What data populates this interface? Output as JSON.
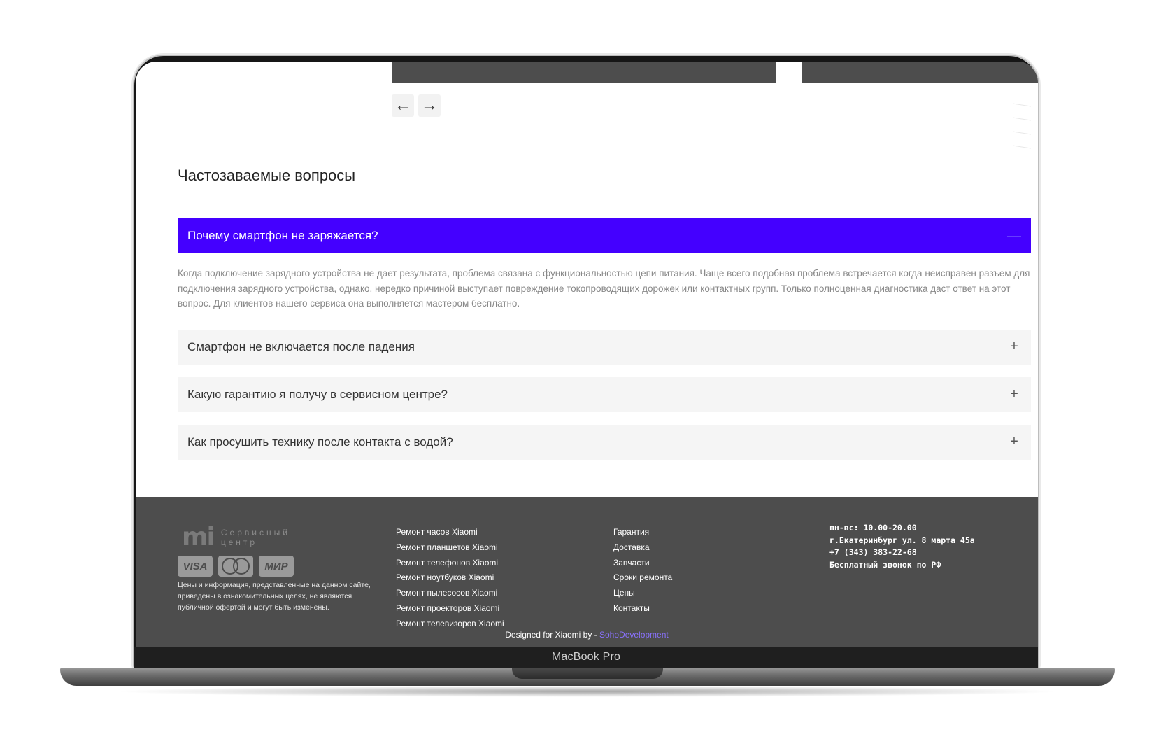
{
  "device": {
    "label": "MacBook Pro"
  },
  "nav": {
    "prev_icon": "arrow-left-icon",
    "next_icon": "arrow-right-icon",
    "prev_glyph": "←",
    "next_glyph": "→"
  },
  "faq": {
    "title": "Частозаваемые вопросы",
    "items": [
      {
        "question": "Почему смартфон не заряжается?",
        "open": true,
        "toggle": "—",
        "answer": "Когда подключение зарядного устройства не дает результата, проблема связана с функциональностью цепи питания. Чаще всего подобная проблема встречается когда неисправен разъем для подключения зарядного устройства, однако, нередко причиной выступает повреждение токопроводящих дорожек или контактных групп. Только полноценная диагностика даст ответ на этот вопрос. Для клиентов нашего сервиса она выполняется мастером бесплатно."
      },
      {
        "question": "Смартфон не включается после падения",
        "open": false,
        "toggle": "+"
      },
      {
        "question": "Какую гарантию я получу в сервисном центре?",
        "open": false,
        "toggle": "+"
      },
      {
        "question": "Как просушить технику после контакта с водой?",
        "open": false,
        "toggle": "+"
      }
    ],
    "accent_color": "#4400ff"
  },
  "footer": {
    "logo": {
      "mark": "mi",
      "line1": "Сервисный",
      "line2": "центр"
    },
    "payments": {
      "visa": "VISA",
      "mir": "МИР",
      "mastercard_icon": "mastercard-icon"
    },
    "disclaimer": "Цены и информация, представленные на данном сайте, приведены в ознакомительных целях, не являются публичной офертой и могут быть изменены.",
    "services": [
      "Ремонт часов Xiaomi",
      "Ремонт планшетов Xiaomi",
      "Ремонт телефонов Xiaomi",
      "Ремонт ноутбуков Xiaomi",
      "Ремонт пылесосов Xiaomi",
      "Ремонт проекторов Xiaomi",
      "Ремонт телевизоров Xiaomi"
    ],
    "links": [
      "Гарантия",
      "Доставка",
      "Запчасти",
      "Сроки ремонта",
      "Цены",
      "Контакты"
    ],
    "contacts": {
      "hours": "пн-вс: 10.00-20.00",
      "address": "г.Екатеринбург ул. 8 марта 45а",
      "phone": "+7 (343) 383-22-68",
      "free_call": "Бесплатный звонок по РФ"
    },
    "credit": {
      "prefix": "Designed for Xiaomi by - ",
      "brand": "SohoDevelopment"
    },
    "background": "#4d4d4d"
  }
}
